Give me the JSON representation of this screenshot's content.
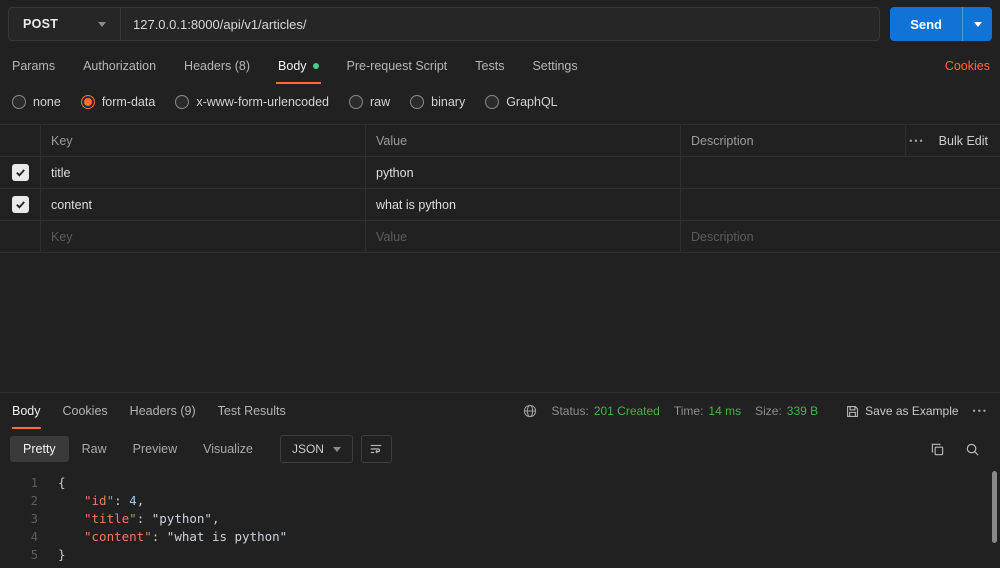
{
  "topbar": {
    "method": "POST",
    "url": "127.0.0.1:8000/api/v1/articles/",
    "send": "Send"
  },
  "request": {
    "tabs": [
      {
        "label": "Params"
      },
      {
        "label": "Authorization"
      },
      {
        "label": "Headers (8)"
      },
      {
        "label": "Body"
      },
      {
        "label": "Pre-request Script"
      },
      {
        "label": "Tests"
      },
      {
        "label": "Settings"
      }
    ],
    "active_tab": "Body",
    "cookies": "Cookies",
    "modes": [
      {
        "label": "none"
      },
      {
        "label": "form-data"
      },
      {
        "label": "x-www-form-urlencoded"
      },
      {
        "label": "raw"
      },
      {
        "label": "binary"
      },
      {
        "label": "GraphQL"
      }
    ],
    "selected_mode": "form-data",
    "table": {
      "columns": {
        "key": "Key",
        "value": "Value",
        "description": "Description"
      },
      "more_icon": "•••",
      "bulk_edit": "Bulk Edit",
      "rows": [
        {
          "key": "title",
          "value": "python",
          "description": "",
          "checked": true
        },
        {
          "key": "content",
          "value": "what is python",
          "description": "",
          "checked": true
        }
      ],
      "placeholders": {
        "key": "Key",
        "value": "Value",
        "description": "Description"
      }
    }
  },
  "response": {
    "tabs": [
      {
        "label": "Body"
      },
      {
        "label": "Cookies"
      },
      {
        "label": "Headers (9)"
      },
      {
        "label": "Test Results"
      }
    ],
    "active_tab": "Body",
    "meta": {
      "status_label": "Status:",
      "status_value": "201 Created",
      "time_label": "Time:",
      "time_value": "14 ms",
      "size_label": "Size:",
      "size_value": "339 B",
      "save_as_example": "Save as Example",
      "more_icon": "•••"
    },
    "views": [
      {
        "label": "Pretty"
      },
      {
        "label": "Raw"
      },
      {
        "label": "Preview"
      },
      {
        "label": "Visualize"
      }
    ],
    "active_view": "Pretty",
    "format": "JSON",
    "code": {
      "lines": [
        {
          "n": "1",
          "open": "{"
        },
        {
          "n": "2",
          "key": "\"id\"",
          "sep": ": ",
          "number": "4",
          "comma": ","
        },
        {
          "n": "3",
          "key": "\"title\"",
          "sep": ": ",
          "string": "\"python\"",
          "comma": ","
        },
        {
          "n": "4",
          "key": "\"content\"",
          "sep": ": ",
          "string": "\"what is python\""
        },
        {
          "n": "5",
          "close": "}"
        }
      ]
    }
  },
  "colors": {
    "accent": "#ff6c37",
    "send_button": "#0f74d6",
    "status_green": "#4caf50",
    "body_dot": "#49cc90",
    "json_key": "#ea7e5c",
    "json_string": "#cdd3da",
    "json_number": "#a6c9e8"
  }
}
